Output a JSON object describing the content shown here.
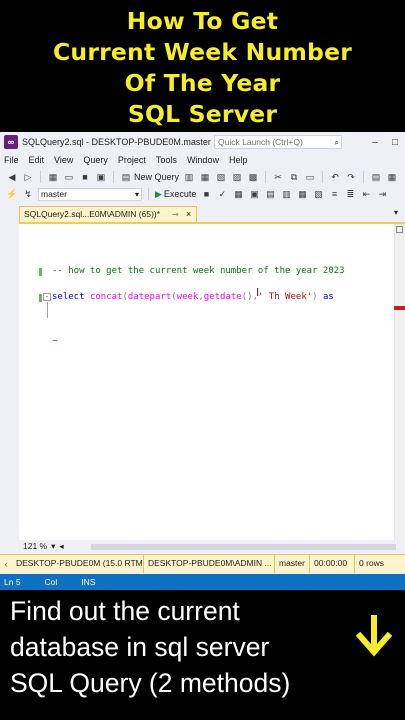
{
  "banner": {
    "lines": [
      "How To Get",
      "Current Week Number",
      "Of The Year",
      "SQL Server"
    ],
    "color": "#f7ec2a"
  },
  "ssms": {
    "window_title": "SQLQuery2.sql - DESKTOP-PBUDE0M.master (...",
    "quick_launch_placeholder": "Quick Launch (Ctrl+Q)",
    "menu": [
      "File",
      "Edit",
      "View",
      "Query",
      "Project",
      "Tools",
      "Window",
      "Help"
    ],
    "new_query_label": "New Query",
    "database_selected": "master",
    "execute_label": "Execute",
    "tab_label": "SQLQuery2.sql...E0M\\ADMIN (65))*",
    "code": {
      "comment": "-- how to get the current week number of the year 2023",
      "kw_select": "select",
      "fn_concat": "concat",
      "fn_datepart": "datepart",
      "arg_week": "week",
      "fn_getdate": "getdate",
      "str_th_week": "' Th Week'",
      "kw_as": "as"
    },
    "zoom": "121 %",
    "query_status": {
      "server": "DESKTOP-PBUDE0M (15.0 RTM)",
      "user": "DESKTOP-PBUDE0M\\ADMIN ...",
      "database": "master",
      "elapsed": "00:00:00",
      "rows": "0 rows"
    },
    "statusbar": {
      "line": "Ln 5",
      "col": "Col",
      "mode": "INS",
      "color": "#0e70c0"
    },
    "accent_tab": "#fff5cc"
  },
  "bottom": {
    "lines": [
      "Find out the current",
      "database in sql server",
      "SQL Query (2 methods)"
    ],
    "arrow_icon": "arrow-down-icon",
    "arrow_color": "#f7ec2a"
  }
}
